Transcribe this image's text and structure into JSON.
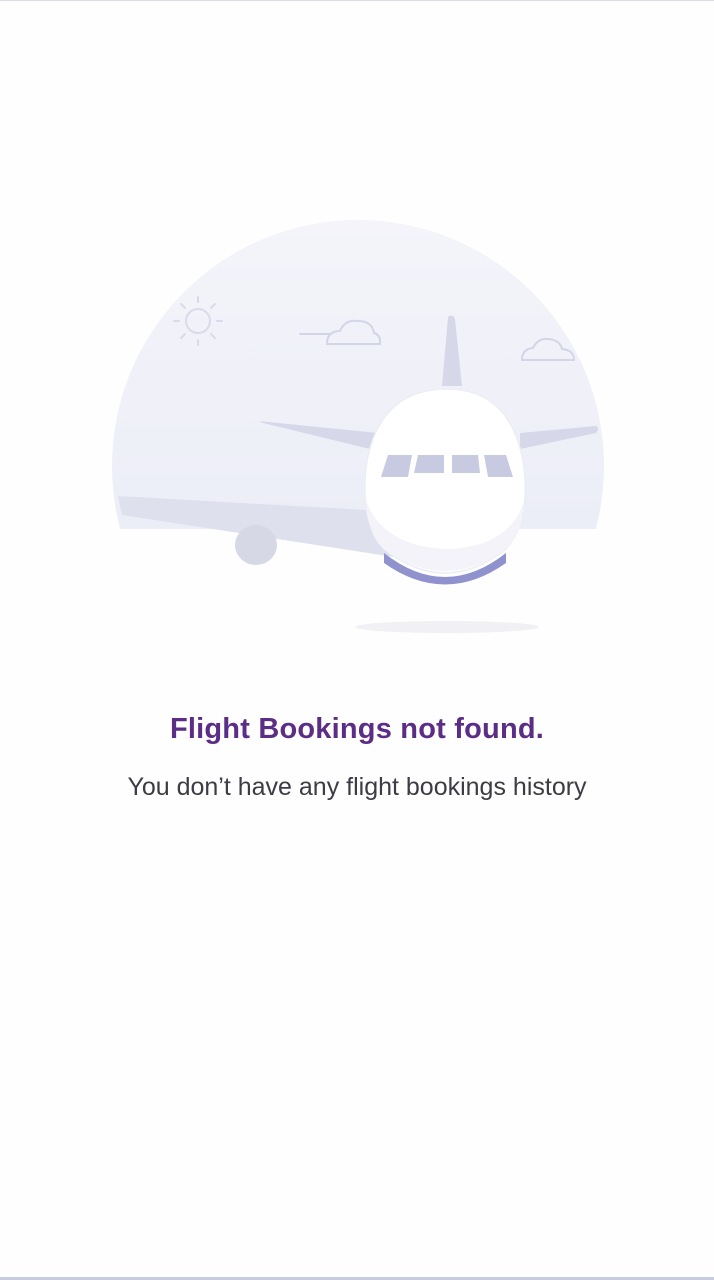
{
  "empty_state": {
    "illustration_icon": "airplane-illustration",
    "title": "Flight Bookings not found.",
    "subtitle": "You don’t have any flight bookings history"
  },
  "colors": {
    "title": "#5b2d86",
    "subtitle": "#3c3c44",
    "illustration_circle": "#eeeff7",
    "plane_body": "#ffffff",
    "plane_accent": "#dcdded",
    "plane_belly": "#8f92cd",
    "outline": "#cfd1e3"
  }
}
